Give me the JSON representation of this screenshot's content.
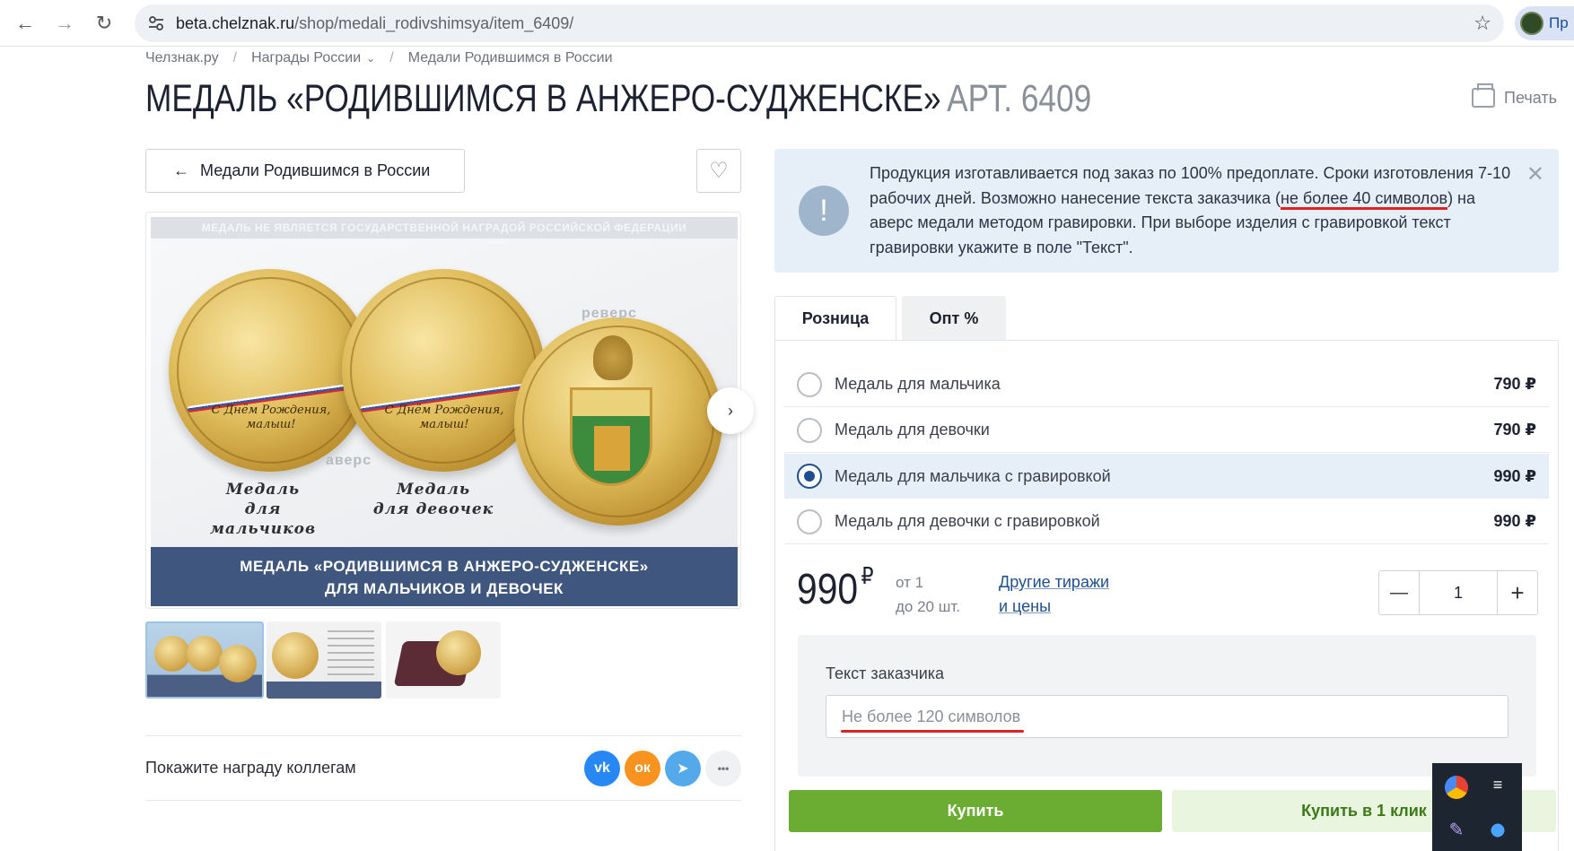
{
  "browser": {
    "back_icon": "arrow-left-icon",
    "forward_icon": "arrow-right-icon",
    "reload_icon": "reload-icon",
    "url_host": "beta.chelznak.ru",
    "url_path": "/shop/medali_rodivshimsya/item_6409/",
    "profile_text": "Пр"
  },
  "breadcrumbs": {
    "items": [
      "Челзнак.ру",
      "Награды России",
      "Медали Родившимся в России"
    ],
    "separator": "/"
  },
  "page": {
    "title": "МЕДАЛЬ «РОДИВШИМСЯ В АНЖЕРО-СУДЖЕНСКЕ»",
    "article": "АРТ. 6409",
    "print_label": "Печать"
  },
  "gallery": {
    "back_label": "Медали Родившимся в России",
    "top_strip": "МЕДАЛЬ НЕ ЯВЛЯЕТСЯ ГОСУДАРСТВЕННОЙ НАГРАДОЙ РОССИЙСКОЙ ФЕДЕРАЦИИ",
    "medal1_text": "С Днём Рождения, малыш!",
    "medal2_text": "С Днём Рождения, малыш!",
    "caption_boys_1": "Медаль",
    "caption_boys_2": "для мальчиков",
    "caption_girls_1": "Медаль",
    "caption_girls_2": "для девочек",
    "avers": "аверс",
    "revers": "реверс",
    "banner_line1": "МЕДАЛЬ «РОДИВШИМСЯ В АНЖЕРО-СУДЖЕНСКЕ»",
    "banner_line2": "ДЛЯ МАЛЬЧИКОВ И ДЕВОЧЕК",
    "thumb_count": 3
  },
  "share": {
    "label": "Покажите награду коллегам",
    "buttons": [
      {
        "name": "vk",
        "text": "vk",
        "color": "#2787f5"
      },
      {
        "name": "ok",
        "text": "ок",
        "color": "#f7931e"
      },
      {
        "name": "telegram",
        "text": "➤",
        "color": "#54a9eb"
      },
      {
        "name": "more",
        "text": "•••",
        "color": "#f0f1f3"
      }
    ]
  },
  "notice": {
    "part1": "Продукция изготавливается под заказ по 100% предоплате. Сроки изготовления 7-10 рабочих дней. Возможно нанесение текста заказчика (",
    "underlined": "не более 40 символов",
    "part2": ") на аверс медали методом гравировки. При выборе изделия с гравировкой текст гравировки укажите в поле \"Текст\"."
  },
  "tabs": {
    "retail": "Розница",
    "wholesale": "Опт %"
  },
  "options": [
    {
      "label": "Медаль для мальчика",
      "price": "790 ₽",
      "selected": false
    },
    {
      "label": "Медаль для девочки",
      "price": "790 ₽",
      "selected": false
    },
    {
      "label": "Медаль для мальчика с гравировкой",
      "price": "990 ₽",
      "selected": true
    },
    {
      "label": "Медаль для девочки с гравировкой",
      "price": "990 ₽",
      "selected": false
    }
  ],
  "price": {
    "value": "990",
    "currency": "₽",
    "range_line1": "от 1",
    "range_line2": "до 20 шт.",
    "other_line1": "Другие тиражи",
    "other_line2": "и цены"
  },
  "quantity": {
    "minus": "—",
    "value": "1",
    "plus": "+"
  },
  "customer_text": {
    "label": "Текст заказчика",
    "placeholder": "Не более 120 символов"
  },
  "actions": {
    "buy": "Купить",
    "buy_one_click": "Купить в 1 клик"
  },
  "colors": {
    "accent_green": "#6bac32",
    "link_blue": "#1f4f8f",
    "notice_bg": "#e6eef7",
    "underline_red": "#dd2222"
  }
}
